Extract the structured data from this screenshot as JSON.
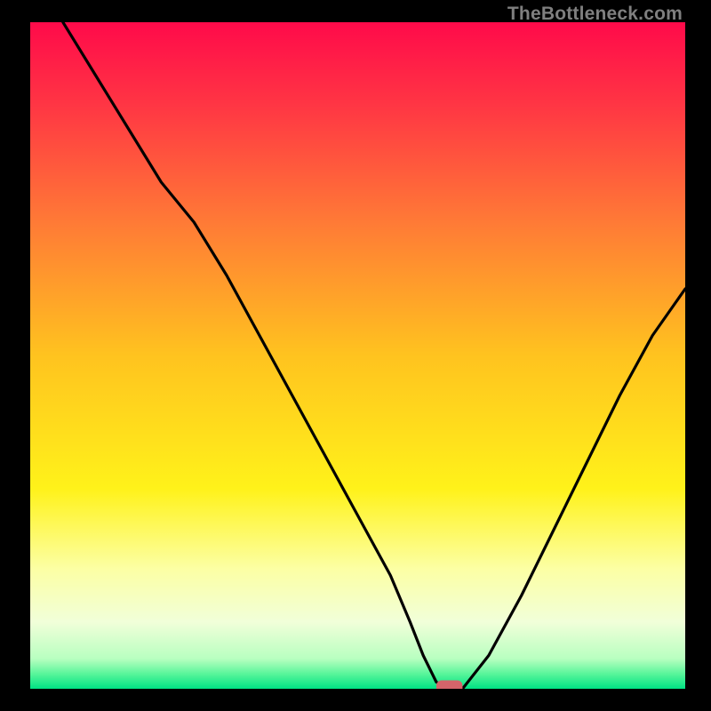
{
  "attribution": "TheBottleneck.com",
  "chart_data": {
    "type": "line",
    "title": "",
    "xlabel": "",
    "ylabel": "",
    "xlim": [
      0,
      100
    ],
    "ylim": [
      0,
      100
    ],
    "background_gradient": {
      "stops": [
        {
          "offset": 0.0,
          "color": "#ff0a4a"
        },
        {
          "offset": 0.12,
          "color": "#ff3444"
        },
        {
          "offset": 0.3,
          "color": "#ff7a36"
        },
        {
          "offset": 0.5,
          "color": "#ffc31f"
        },
        {
          "offset": 0.7,
          "color": "#fff21a"
        },
        {
          "offset": 0.82,
          "color": "#fcffa4"
        },
        {
          "offset": 0.9,
          "color": "#f1ffd9"
        },
        {
          "offset": 0.955,
          "color": "#b8ffc0"
        },
        {
          "offset": 0.978,
          "color": "#57f59a"
        },
        {
          "offset": 1.0,
          "color": "#00e184"
        }
      ]
    },
    "series": [
      {
        "name": "bottleneck-curve",
        "color": "#000000",
        "x": [
          5,
          10,
          15,
          20,
          25,
          30,
          35,
          40,
          45,
          50,
          55,
          58,
          60,
          62,
          64,
          66,
          70,
          75,
          80,
          85,
          90,
          95,
          100
        ],
        "y": [
          100,
          92,
          84,
          76,
          70,
          62,
          53,
          44,
          35,
          26,
          17,
          10,
          5,
          1,
          0,
          0,
          5,
          14,
          24,
          34,
          44,
          53,
          60
        ]
      }
    ],
    "marker": {
      "name": "optimum-marker",
      "x": 64,
      "y": 0,
      "color": "#d5646a",
      "width": 4,
      "height": 2
    }
  }
}
